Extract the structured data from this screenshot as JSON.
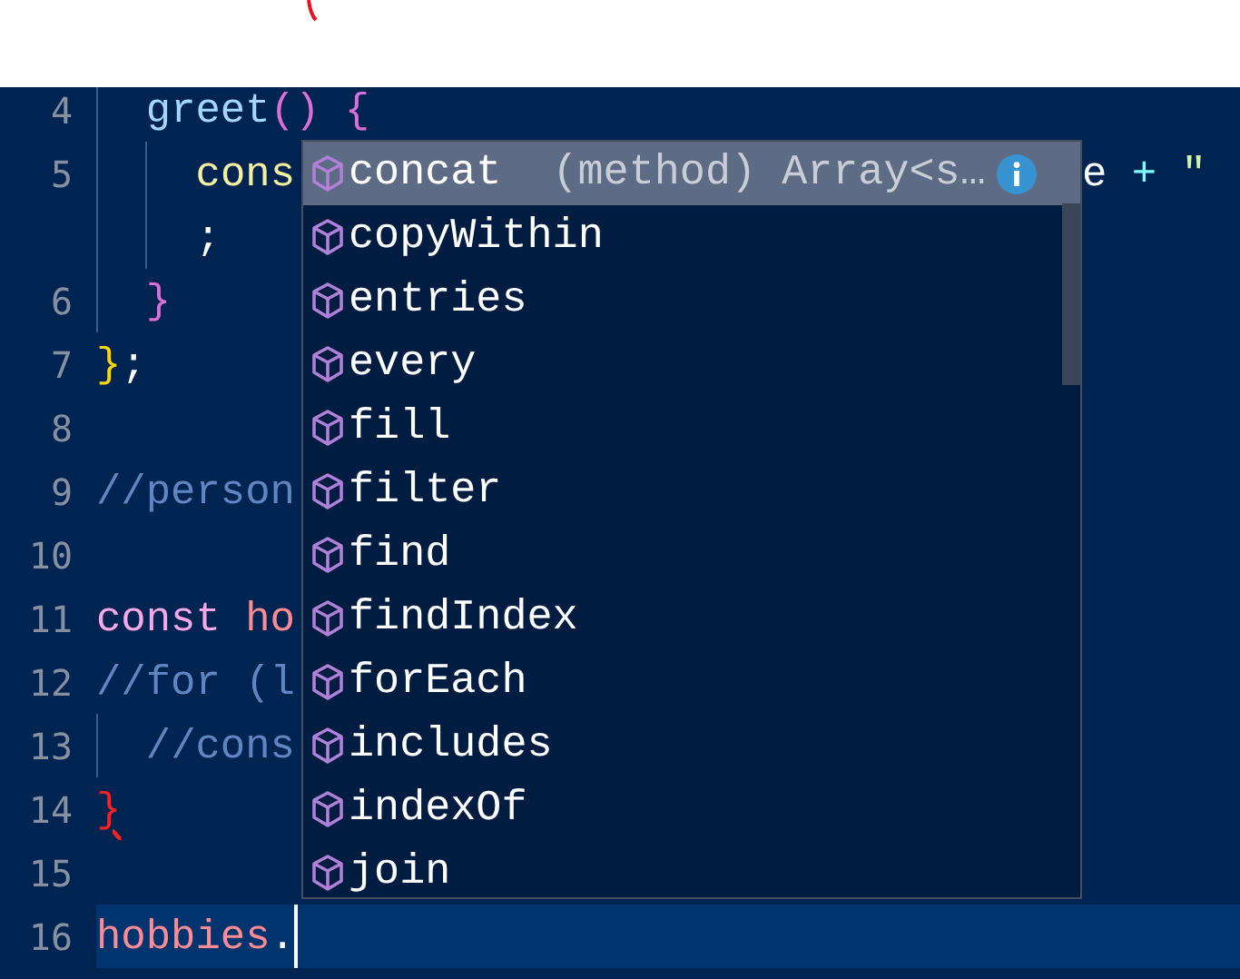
{
  "lines": [
    {
      "number": "4",
      "tokens": [
        {
          "text": "  greet",
          "kind": "method"
        },
        {
          "text": "()",
          "kind": "bracket2"
        },
        {
          "text": " {",
          "kind": "bracket2"
        }
      ]
    },
    {
      "number": "5",
      "tokens": [
        {
          "text": "    cons",
          "kind": "keyword2"
        }
      ],
      "right": [
        {
          "text": "e",
          "kind": "plain"
        },
        {
          "text": " + ",
          "kind": "operator"
        },
        {
          "text": "\" ",
          "kind": "string"
        }
      ]
    },
    {
      "tokens": [
        {
          "text": "    ;",
          "kind": "plain"
        }
      ]
    },
    {
      "number": "6",
      "tokens": [
        {
          "text": "  }",
          "kind": "bracket2"
        }
      ]
    },
    {
      "number": "7",
      "tokens": [
        {
          "text": "}",
          "kind": "bracket1"
        },
        {
          "text": ";",
          "kind": "plain"
        }
      ]
    },
    {
      "number": "8"
    },
    {
      "number": "9",
      "tokens": [
        {
          "text": "//person",
          "kind": "comment"
        }
      ]
    },
    {
      "number": "10"
    },
    {
      "number": "11",
      "tokens": [
        {
          "text": "const",
          "kind": "keyword"
        },
        {
          "text": " ho",
          "kind": "variable"
        }
      ]
    },
    {
      "number": "12",
      "tokens": [
        {
          "text": "//for (l",
          "kind": "comment"
        }
      ]
    },
    {
      "number": "13",
      "tokens": [
        {
          "text": "  //cons",
          "kind": "comment"
        }
      ]
    },
    {
      "number": "14",
      "tokens": [
        {
          "text": "}",
          "kind": "error"
        }
      ]
    },
    {
      "number": "15"
    },
    {
      "number": "16",
      "current": true,
      "tokens": [
        {
          "text": "hobbies",
          "kind": "variable"
        },
        {
          "text": ".",
          "kind": "plain"
        }
      ]
    }
  ],
  "suggestions": [
    {
      "label": "concat",
      "detail": "(method) Array<s…",
      "selected": true
    },
    {
      "label": "copyWithin",
      "selected": false
    },
    {
      "label": "entries",
      "selected": false
    },
    {
      "label": "every",
      "selected": false
    },
    {
      "label": "fill",
      "selected": false
    },
    {
      "label": "filter",
      "selected": false
    },
    {
      "label": "find",
      "selected": false
    },
    {
      "label": "findIndex",
      "selected": false
    },
    {
      "label": "forEach",
      "selected": false
    },
    {
      "label": "includes",
      "selected": false
    },
    {
      "label": "indexOf",
      "selected": false
    },
    {
      "label": "join",
      "selected": false
    }
  ]
}
